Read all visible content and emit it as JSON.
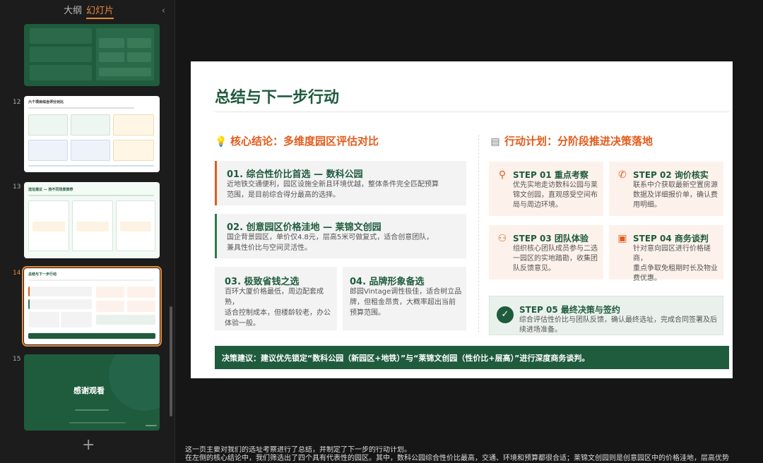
{
  "panel": {
    "tab_outline": "大纲",
    "tab_slides": "幻灯片",
    "collapse": "‹"
  },
  "thumbs": [
    {
      "num": "",
      "type": "green-list"
    },
    {
      "num": "12",
      "title": "六个项目综合评分对比"
    },
    {
      "num": "13",
      "title": "选址建议 — 按不同场景推荐"
    },
    {
      "num": "14",
      "title": "总结与下一步行动",
      "active": true
    },
    {
      "num": "15",
      "title": "感谢观看"
    }
  ],
  "slide": {
    "title": "总结与下一步行动",
    "left_head": "核心结论：多维度园区评估对比",
    "right_head": "行动计划：分阶段推进决策落地",
    "cards": [
      {
        "title": "01. 综合性价比首选 — 数科公园",
        "body_1": "近地铁交通便利，园区设施全新且环境优越，整体条件完全匹配预算",
        "body_2": "范围，是目前综合得分最高的选择。"
      },
      {
        "title": "02. 创意园区价格洼地 — 莱锦文创园",
        "body_1": "国企背景园区，单价仅4.8元，层高5米可做复式，适合创意团队，",
        "body_2": "兼具性价比与空间灵活性。"
      },
      {
        "title": "03. 极致省钱之选",
        "body_1": "百环大厦价格最低，周边配套成熟，",
        "body_2": "适合控制成本，但楼龄较老，办公",
        "body_3": "体验一般。"
      },
      {
        "title": "04. 品牌形象备选",
        "body_1": "郎园Vintage调性极佳，适合树立品",
        "body_2": "牌，但租金昂贵，大概率超出当前",
        "body_3": "预算范围。"
      }
    ],
    "steps": [
      {
        "title": "STEP 01 重点考察",
        "body_1": "优先实地走访数科公园与莱",
        "body_2": "锦文创园，直观感受空间布",
        "body_3": "局与周边环境。"
      },
      {
        "title": "STEP 02 询价核实",
        "body_1": "联系中介获取最新空置房源",
        "body_2": "数据及详细报价单，确认费",
        "body_3": "用明细。"
      },
      {
        "title": "STEP 03 团队体验",
        "body_1": "组织核心团队成员参与二选",
        "body_2": "一园区的实地踏勘，收集团",
        "body_3": "队反馈意见。"
      },
      {
        "title": "STEP 04 商务谈判",
        "body_1": "针对意向园区进行价格磋商，",
        "body_2": "重点争取免租期时长及物业",
        "body_3": "费优惠。"
      }
    ],
    "step5": {
      "title": "STEP 05 最终决策与签约",
      "body_1": "综合评估性价比与团队反馈，确认最终选址，完成合同签署及后",
      "body_2": "续进场准备。"
    },
    "decision": "决策建议：建议优先锁定“数科公园（新园区+地铁）”与“莱锦文创园（性价比+层高）”进行深度商务谈判。"
  },
  "notes": {
    "line_1": "这一页主要对我们的选址考察进行了总结，并制定了下一步的行动计划。",
    "line_2": "在左侧的核心结论中，我们筛选出了四个具有代表性的园区。其中，数科公园综合性价比最高，交通、环境和预算都很合适；莱锦文创园则是创意园区中的价格洼地，层高优势"
  },
  "colors": {
    "brand_green": "#1f5b3d",
    "accent_orange": "#e35c1c",
    "active_outline": "#e8883a"
  }
}
